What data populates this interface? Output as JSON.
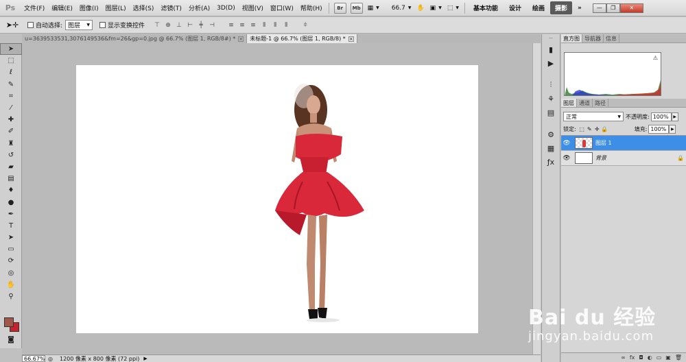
{
  "app": {
    "logo": "Ps"
  },
  "menu": {
    "items": [
      "文件(F)",
      "编辑(E)",
      "图像(I)",
      "图层(L)",
      "选择(S)",
      "滤镜(T)",
      "分析(A)",
      "3D(D)",
      "视图(V)",
      "窗口(W)",
      "帮助(H)"
    ],
    "buttons": [
      "Br",
      "Mb"
    ],
    "zoom_value": "66.7",
    "workspaces": [
      "基本功能",
      "设计",
      "绘画"
    ],
    "active_workspace": "摄影",
    "more": "»"
  },
  "options": {
    "auto_select_label": "自动选择:",
    "auto_select_target": "图层",
    "show_transform_label": "显示变换控件"
  },
  "tabs": [
    {
      "label": "u=3639533531,3076149536&fm=26&gp=0.jpg @ 66.7% (图层 1, RGB/8#) *",
      "active": false
    },
    {
      "label": "未标题-1 @ 66.7% (图层 1, RGB/8) *",
      "active": true
    }
  ],
  "status": {
    "zoom": "66.67%",
    "doc_info": "1200 像素 x 800 像素 (72 ppi)"
  },
  "panels": {
    "top_tabs": [
      "直方图",
      "导航器",
      "信息"
    ],
    "histogram_warning": "⚠",
    "layer_tabs": [
      "图层",
      "通道",
      "路径"
    ],
    "blend_mode": "正常",
    "opacity_label": "不透明度:",
    "opacity_value": "100%",
    "lock_label": "锁定:",
    "fill_label": "填充:",
    "fill_value": "100%",
    "layers": [
      {
        "name": "图层 1",
        "selected": true
      },
      {
        "name": "背景",
        "selected": false,
        "locked": true
      }
    ]
  },
  "watermark": {
    "brand": "Bai du 经验",
    "url": "jingyan.baidu.com"
  },
  "colors": {
    "foreground": "#a05648",
    "background": "#c8232b",
    "dress": "#d9283a",
    "selection": "#3d8ee7"
  }
}
